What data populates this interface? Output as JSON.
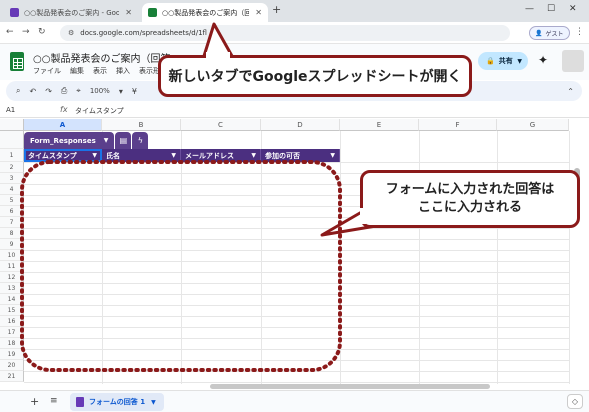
{
  "browser": {
    "tabs": [
      {
        "title": "○○製品発表会のご案内 - Goog",
        "active": false,
        "icon_color": "#673ab7"
      },
      {
        "title": "○○製品発表会のご案内（回答",
        "active": true,
        "icon_color": "#188038"
      }
    ],
    "new_tab": "+",
    "url": "docs.google.com/spreadsheets/d/1fl",
    "guest_label": "ゲスト"
  },
  "sheets": {
    "doc_title": "○○製品発表会のご案内（回答",
    "menu": [
      "ファイル",
      "編集",
      "表示",
      "挿入",
      "表示形"
    ],
    "share_label": "共有",
    "toolbar": {
      "zoom": "100%"
    },
    "name_box": "A1",
    "formula_value": "タイムスタンプ",
    "columns": [
      "A",
      "B",
      "C",
      "D",
      "E",
      "F",
      "G"
    ],
    "rows": [
      "1",
      "2",
      "3",
      "4",
      "5",
      "6",
      "7",
      "8",
      "9",
      "10",
      "11",
      "12",
      "13",
      "14",
      "15",
      "16",
      "17",
      "18",
      "19",
      "20",
      "21"
    ],
    "table_name": "Form_Responses",
    "table_headers": [
      "タイムスタンプ",
      "氏名",
      "メールアドレス",
      "参加の可否"
    ],
    "sheet_tab": "フォームの回答 1"
  },
  "annotations": {
    "callout1": "新しいタブでGoogleスプレッドシートが開く",
    "callout2_line1": "フォームに入力された回答は",
    "callout2_line2": "ここに入力される",
    "color": "#8b1a1a"
  }
}
